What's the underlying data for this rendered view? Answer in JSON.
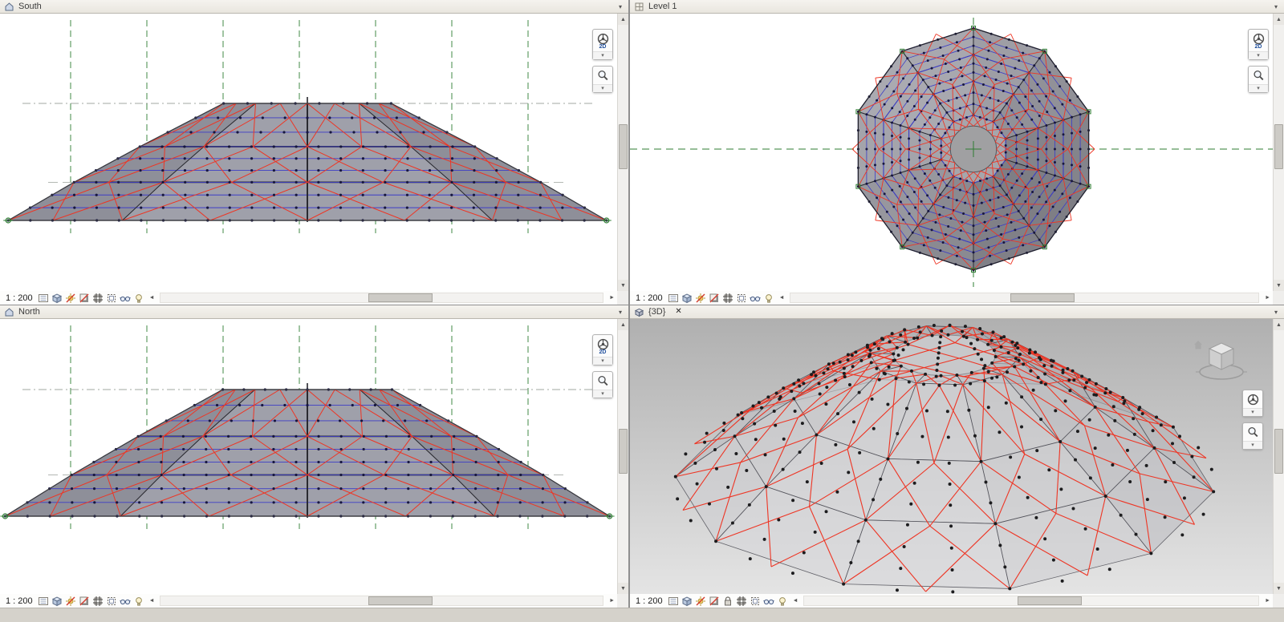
{
  "viewports": {
    "south": {
      "title": "South",
      "scale": "1 : 200"
    },
    "level1": {
      "title": "Level 1",
      "scale": "1 : 200"
    },
    "north": {
      "title": "North",
      "scale": "1 : 200"
    },
    "threed": {
      "title": "{3D}",
      "scale": "1 : 200",
      "close_glyph": "✕"
    }
  },
  "titlebar": {
    "menu_arrow": "▾"
  },
  "navbar": {
    "wheel_2d_label": "2D",
    "dropdown_arrow": "▾"
  },
  "view_control_bar": {
    "icons_2d": [
      "detail-level",
      "visual-style",
      "sun-path",
      "shadows",
      "crop-view",
      "show-crop-region",
      "temporary-hide-isolate",
      "reveal-hidden-elements"
    ],
    "icons_3d": [
      "detail-level",
      "visual-style",
      "sun-path",
      "shadows",
      "lock-3d-view",
      "crop-view",
      "show-crop-region",
      "temporary-hide-isolate",
      "reveal-hidden-elements"
    ]
  },
  "scrollbar": {
    "up_glyph": "▲",
    "down_glyph": "▼",
    "left_glyph": "◄",
    "right_glyph": "►"
  },
  "colors": {
    "grid_green": "#2e7d32",
    "structure_blue": "#3d3dc6",
    "structure_red": "#ee3524",
    "dot_dark": "#17173f",
    "panel_gray": "#9a9aa2",
    "bg_3d_top": "#b0b0b0",
    "bg_3d_bottom": "#e4e4e4"
  }
}
